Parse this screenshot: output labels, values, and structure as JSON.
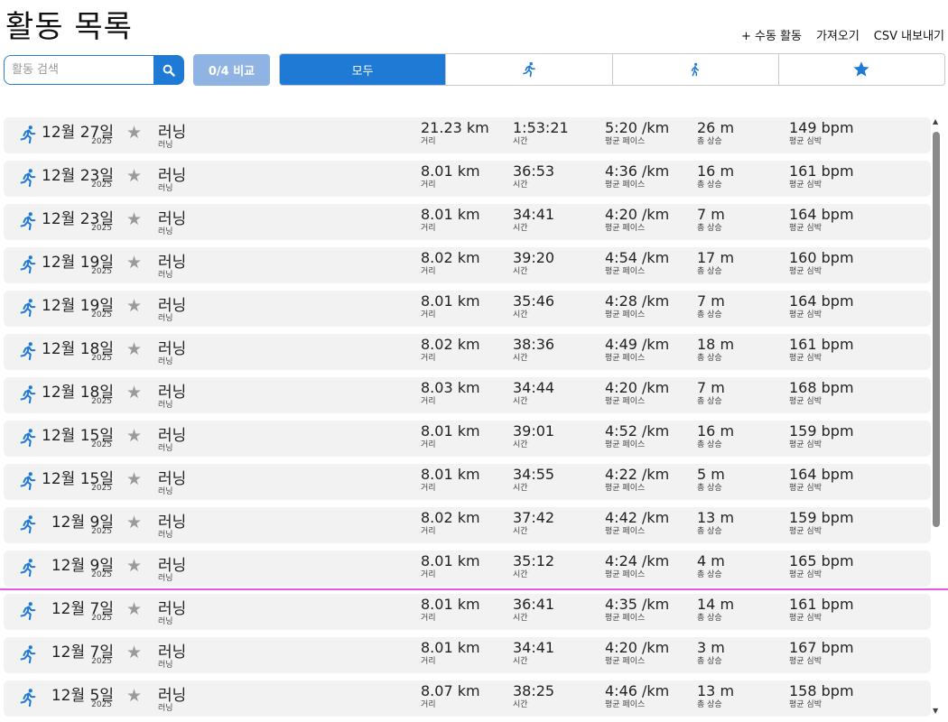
{
  "header": {
    "title": "활동 목록",
    "links": [
      "+ 수동 활동",
      "가져오기",
      "CSV 내보내기"
    ]
  },
  "search": {
    "placeholder": "활동 검색",
    "value": ""
  },
  "compare": {
    "label": "0/4 비교"
  },
  "filters": {
    "all_label": "모두",
    "icons": [
      "running-icon",
      "walking-icon",
      "star-icon"
    ]
  },
  "metric_labels": {
    "distance": "거리",
    "time": "시간",
    "pace": "평균 페이스",
    "elevation": "총 상승",
    "heart_rate": "평균 심박"
  },
  "activities": [
    {
      "date": "12월 27일",
      "year": "2025",
      "name": "러닝",
      "type": "러닝",
      "distance": "21.23 km",
      "time": "1:53:21",
      "pace": "5:20 /km",
      "elevation": "26 m",
      "heart_rate": "149 bpm"
    },
    {
      "date": "12월 23일",
      "year": "2025",
      "name": "러닝",
      "type": "러닝",
      "distance": "8.01 km",
      "time": "36:53",
      "pace": "4:36 /km",
      "elevation": "16 m",
      "heart_rate": "161 bpm"
    },
    {
      "date": "12월 23일",
      "year": "2025",
      "name": "러닝",
      "type": "러닝",
      "distance": "8.01 km",
      "time": "34:41",
      "pace": "4:20 /km",
      "elevation": "7 m",
      "heart_rate": "164 bpm"
    },
    {
      "date": "12월 19일",
      "year": "2025",
      "name": "러닝",
      "type": "러닝",
      "distance": "8.02 km",
      "time": "39:20",
      "pace": "4:54 /km",
      "elevation": "17 m",
      "heart_rate": "160 bpm"
    },
    {
      "date": "12월 19일",
      "year": "2025",
      "name": "러닝",
      "type": "러닝",
      "distance": "8.01 km",
      "time": "35:46",
      "pace": "4:28 /km",
      "elevation": "7 m",
      "heart_rate": "164 bpm"
    },
    {
      "date": "12월 18일",
      "year": "2025",
      "name": "러닝",
      "type": "러닝",
      "distance": "8.02 km",
      "time": "38:36",
      "pace": "4:49 /km",
      "elevation": "18 m",
      "heart_rate": "161 bpm"
    },
    {
      "date": "12월 18일",
      "year": "2025",
      "name": "러닝",
      "type": "러닝",
      "distance": "8.03 km",
      "time": "34:44",
      "pace": "4:20 /km",
      "elevation": "7 m",
      "heart_rate": "168 bpm"
    },
    {
      "date": "12월 15일",
      "year": "2025",
      "name": "러닝",
      "type": "러닝",
      "distance": "8.01 km",
      "time": "39:01",
      "pace": "4:52 /km",
      "elevation": "16 m",
      "heart_rate": "159 bpm"
    },
    {
      "date": "12월 15일",
      "year": "2025",
      "name": "러닝",
      "type": "러닝",
      "distance": "8.01 km",
      "time": "34:55",
      "pace": "4:22 /km",
      "elevation": "5 m",
      "heart_rate": "164 bpm"
    },
    {
      "date": "12월 9일",
      "year": "2025",
      "name": "러닝",
      "type": "러닝",
      "distance": "8.02 km",
      "time": "37:42",
      "pace": "4:42 /km",
      "elevation": "13 m",
      "heart_rate": "159 bpm"
    },
    {
      "date": "12월 9일",
      "year": "2025",
      "name": "러닝",
      "type": "러닝",
      "distance": "8.01 km",
      "time": "35:12",
      "pace": "4:24 /km",
      "elevation": "4 m",
      "heart_rate": "165 bpm"
    },
    {
      "date": "12월 7일",
      "year": "2025",
      "name": "러닝",
      "type": "러닝",
      "distance": "8.01 km",
      "time": "36:41",
      "pace": "4:35 /km",
      "elevation": "14 m",
      "heart_rate": "161 bpm"
    },
    {
      "date": "12월 7일",
      "year": "2025",
      "name": "러닝",
      "type": "러닝",
      "distance": "8.01 km",
      "time": "34:41",
      "pace": "4:20 /km",
      "elevation": "3 m",
      "heart_rate": "167 bpm"
    },
    {
      "date": "12월 5일",
      "year": "2025",
      "name": "러닝",
      "type": "러닝",
      "distance": "8.07 km",
      "time": "38:25",
      "pace": "4:46 /km",
      "elevation": "13 m",
      "heart_rate": "158 bpm"
    }
  ],
  "colors": {
    "accent": "#1f7ad6",
    "compare_disabled": "#8fb4e4",
    "row_bg": "#f2f2f2",
    "star_gray": "#9a9a9a",
    "divider_magenta": "#e05be0"
  }
}
